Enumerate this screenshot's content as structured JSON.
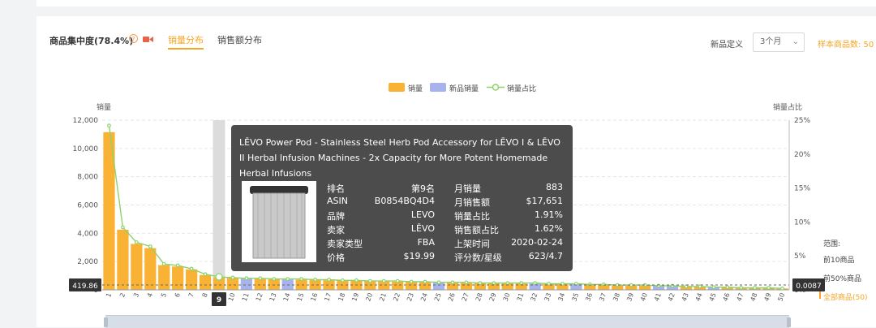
{
  "header": {
    "title": "商品集中度(78.4%)",
    "help_icon": "?",
    "tabs": [
      {
        "label": "销量分布",
        "active": true
      },
      {
        "label": "销售额分布",
        "active": false
      }
    ],
    "new_product_label": "新品定义",
    "new_product_select": "3个月",
    "sample_label": "样本商品数: 50"
  },
  "colors": {
    "accent": "#f6a623",
    "bar": "#f9b233",
    "new_bar": "#a8b3ee",
    "line": "#8ed26c"
  },
  "chart_data": {
    "type": "bar",
    "legend": [
      "销量",
      "新品销量",
      "销量占比"
    ],
    "ylabel": "销量",
    "y2label": "销量占比",
    "ylim": [
      0,
      12000
    ],
    "y2lim": [
      0,
      25
    ],
    "yticks": [
      "0",
      "2,000",
      "4,000",
      "6,000",
      "8,000",
      "10,000",
      "12,000"
    ],
    "y2ticks": [
      "0%",
      "5%",
      "10%",
      "15%",
      "20%",
      "25%"
    ],
    "categories": [
      "1",
      "2",
      "3",
      "4",
      "5",
      "6",
      "7",
      "8",
      "9",
      "10",
      "11",
      "12",
      "13",
      "14",
      "15",
      "16",
      "17",
      "18",
      "19",
      "20",
      "21",
      "22",
      "23",
      "24",
      "25",
      "26",
      "27",
      "28",
      "29",
      "30",
      "31",
      "32",
      "33",
      "34",
      "35",
      "36",
      "37",
      "38",
      "39",
      "40",
      "41",
      "42",
      "43",
      "44",
      "45",
      "46",
      "47",
      "48",
      "49",
      "50"
    ],
    "series": [
      {
        "name": "销量",
        "values": [
          11150,
          4250,
          3250,
          2950,
          1750,
          1650,
          1450,
          1050,
          883,
          840,
          800,
          780,
          760,
          740,
          720,
          700,
          680,
          660,
          640,
          620,
          600,
          580,
          560,
          540,
          520,
          500,
          490,
          480,
          470,
          460,
          450,
          440,
          430,
          420,
          400,
          380,
          360,
          340,
          320,
          300,
          280,
          260,
          240,
          220,
          200,
          180,
          160,
          140,
          120,
          100
        ]
      },
      {
        "name": "新品销量",
        "values": [
          0,
          0,
          0,
          0,
          0,
          0,
          0,
          0,
          0,
          0,
          800,
          0,
          0,
          740,
          0,
          0,
          0,
          0,
          0,
          0,
          0,
          0,
          0,
          0,
          520,
          0,
          0,
          0,
          0,
          0,
          0,
          440,
          0,
          0,
          400,
          0,
          0,
          0,
          0,
          0,
          280,
          260,
          0,
          0,
          200,
          0,
          0,
          0,
          0,
          0
        ]
      },
      {
        "name": "销量占比",
        "values": [
          24.2,
          9.2,
          7.0,
          6.4,
          3.8,
          3.6,
          3.1,
          2.3,
          1.91,
          1.8,
          1.7,
          1.7,
          1.6,
          1.6,
          1.6,
          1.5,
          1.5,
          1.4,
          1.4,
          1.3,
          1.3,
          1.3,
          1.2,
          1.2,
          1.1,
          1.1,
          1.1,
          1.0,
          1.0,
          1.0,
          1.0,
          1.0,
          0.9,
          0.9,
          0.9,
          0.8,
          0.8,
          0.7,
          0.7,
          0.7,
          0.6,
          0.6,
          0.5,
          0.5,
          0.4,
          0.4,
          0.3,
          0.3,
          0.3,
          0.2
        ]
      }
    ],
    "highlight_index": 8,
    "avg_left_label": "419.86",
    "avg_right_label": "0.0087"
  },
  "tooltip": {
    "title": "LĒVO Power Pod - Stainless Steel Herb Pod Accessory for LĒVO I & LĒVO II Herbal Infusion Machines - 2x Capacity for More Potent Homemade Herbal Infusions",
    "rows": [
      {
        "k1": "排名",
        "v1": "第9名",
        "k2": "月销量",
        "v2": "883"
      },
      {
        "k1": "ASIN",
        "v1": "B0854BQ4D4",
        "k2": "月销售额",
        "v2": "$17,651"
      },
      {
        "k1": "品牌",
        "v1": "LEVO",
        "k2": "销量占比",
        "v2": "1.91%"
      },
      {
        "k1": "卖家",
        "v1": "LĒVO",
        "k2": "销售额占比",
        "v2": "1.62%"
      },
      {
        "k1": "卖家类型",
        "v1": "FBA",
        "k2": "上架时间",
        "v2": "2020-02-24"
      },
      {
        "k1": "价格",
        "v1": "$19.99",
        "k2": "评分数/星级",
        "v2": "623/4.7"
      }
    ]
  },
  "range": {
    "title": "范围:",
    "items": [
      {
        "label": "前10商品",
        "active": false
      },
      {
        "label": "前50%商品",
        "active": false
      },
      {
        "label": "全部商品(50)",
        "active": true
      }
    ]
  }
}
